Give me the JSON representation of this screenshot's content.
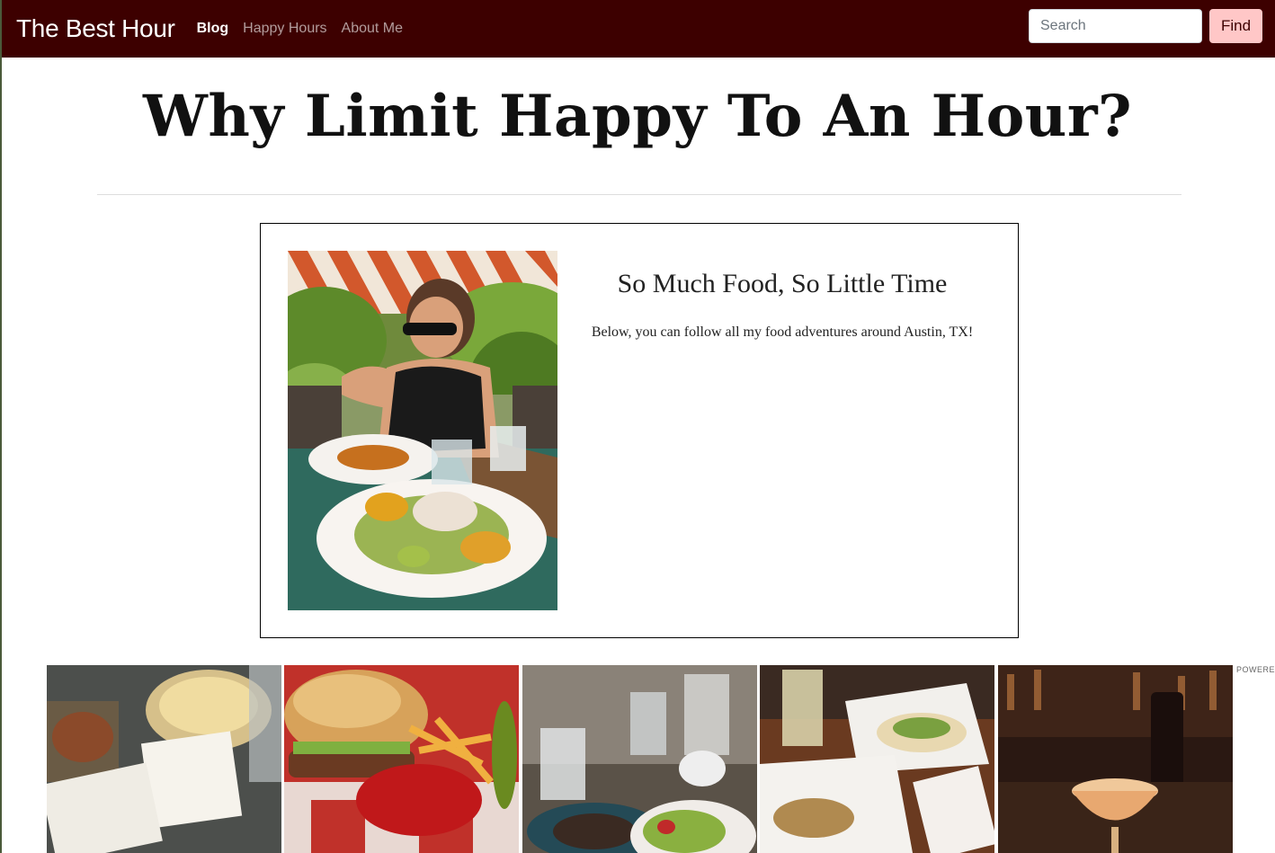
{
  "navbar": {
    "brand": "The Best Hour",
    "links": [
      "Blog",
      "Happy Hours",
      "About Me"
    ],
    "search_placeholder": "Search",
    "find_label": "Find",
    "bg_color": "#3d0000",
    "button_color": "#ffc7c7"
  },
  "hero": {
    "title": "Why Limit Happy To An Hour?"
  },
  "post": {
    "title": "So Much Food, So Little Time",
    "text": "Below, you can follow all my food adventures around Austin, TX!"
  },
  "feed": {
    "powered_label": "POWERED"
  }
}
